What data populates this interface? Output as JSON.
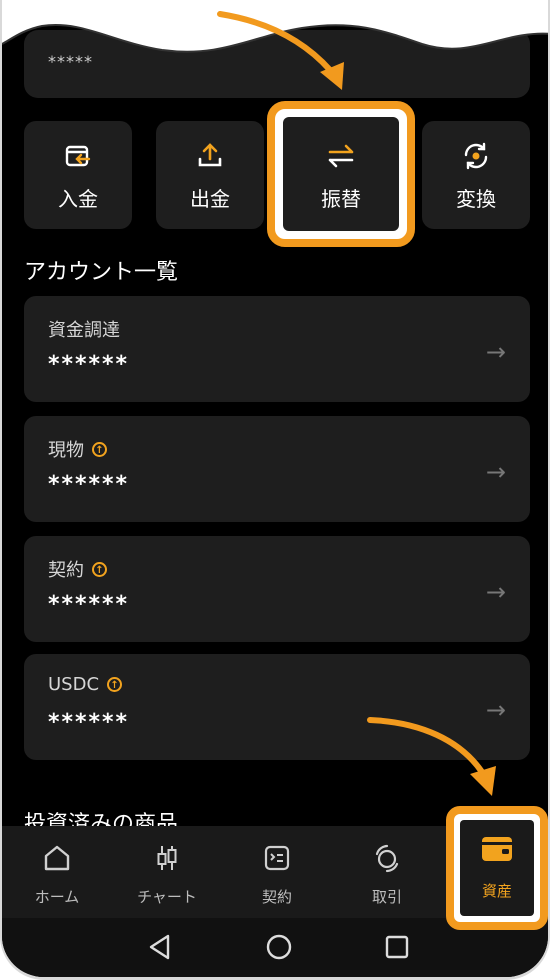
{
  "top_card": {
    "masked_value": "*****"
  },
  "actions": [
    {
      "label": "入金",
      "icon": "deposit-icon"
    },
    {
      "label": "出金",
      "icon": "withdraw-icon"
    },
    {
      "label": "振替",
      "icon": "transfer-icon"
    },
    {
      "label": "変換",
      "icon": "convert-icon"
    }
  ],
  "section_title": "アカウント一覧",
  "accounts": [
    {
      "name": "資金調達",
      "value": "******",
      "badge": false
    },
    {
      "name": "現物",
      "value": "******",
      "badge": true
    },
    {
      "name": "契約",
      "value": "******",
      "badge": true
    },
    {
      "name": "USDC",
      "value": "******",
      "badge": true
    }
  ],
  "next_section_title": "投資済みの商品",
  "nav": [
    {
      "label": "ホーム",
      "icon": "home-icon"
    },
    {
      "label": "チャート",
      "icon": "candlestick-icon"
    },
    {
      "label": "契約",
      "icon": "contract-icon"
    },
    {
      "label": "取引",
      "icon": "trade-icon"
    },
    {
      "label": "資産",
      "icon": "wallet-icon",
      "active": true
    }
  ],
  "colors": {
    "accent": "#f29a1e",
    "background": "#000000",
    "card": "#1e1e1e"
  }
}
